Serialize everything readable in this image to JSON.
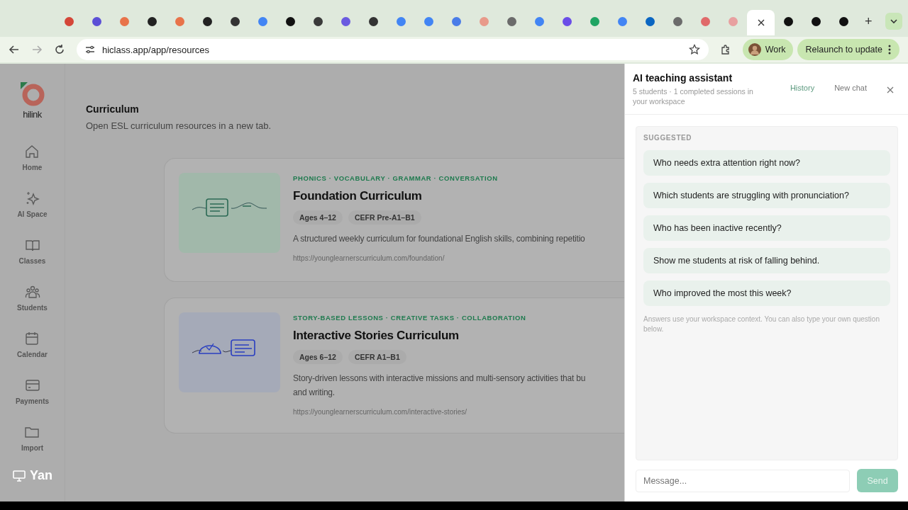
{
  "browser": {
    "tabs": [
      {
        "color": "#d44638",
        "selected": false
      },
      {
        "color": "#5b4fd6",
        "selected": false
      },
      {
        "color": "#e8734a",
        "selected": false
      },
      {
        "color": "#222222",
        "selected": false
      },
      {
        "color": "#e8734a",
        "selected": false
      },
      {
        "color": "#222222",
        "selected": false
      },
      {
        "color": "#333333",
        "selected": false
      },
      {
        "color": "#4285f4",
        "selected": false
      },
      {
        "color": "#111111",
        "selected": false
      },
      {
        "color": "#3a3a3a",
        "selected": false
      },
      {
        "color": "#6a5ae0",
        "selected": false
      },
      {
        "color": "#333333",
        "selected": false
      },
      {
        "color": "#4285f4",
        "selected": false
      },
      {
        "color": "#4285f4",
        "selected": false
      },
      {
        "color": "#4a7ce8",
        "selected": false
      },
      {
        "color": "#e89a8a",
        "selected": false
      },
      {
        "color": "#6b6b6b",
        "selected": false
      },
      {
        "color": "#4285f4",
        "selected": false
      },
      {
        "color": "#6a4de8",
        "selected": false
      },
      {
        "color": "#1fa463",
        "selected": false
      },
      {
        "color": "#4285f4",
        "selected": false
      },
      {
        "color": "#0a66c2",
        "selected": false
      },
      {
        "color": "#6b6b6b",
        "selected": false
      },
      {
        "color": "#e06a6a",
        "selected": false
      },
      {
        "color": "#e8a0a0",
        "selected": false
      },
      {
        "selected": true
      },
      {
        "color": "#111111",
        "selected": false
      },
      {
        "color": "#111111",
        "selected": false
      },
      {
        "color": "#111111",
        "selected": false
      }
    ],
    "new_tab": "+",
    "url": "hiclass.app/app/resources",
    "profile": "Work",
    "relaunch": "Relaunch to update"
  },
  "sidebar": {
    "logo_text": "hilink",
    "items": [
      {
        "label": "Home",
        "kind": "home"
      },
      {
        "label": "AI Space",
        "kind": "ai"
      },
      {
        "label": "Classes",
        "kind": "book"
      },
      {
        "label": "Students",
        "kind": "people"
      },
      {
        "label": "Calendar",
        "kind": "calendar"
      },
      {
        "label": "Payments",
        "kind": "card"
      },
      {
        "label": "Import",
        "kind": "folder"
      }
    ]
  },
  "page": {
    "title": "Curriculum",
    "subtitle": "Open ESL curriculum resources in a new tab.",
    "cards": [
      {
        "kind": "foundation",
        "tags": "PHONICS · VOCABULARY · GRAMMAR · CONVERSATION",
        "title": "Foundation Curriculum",
        "badges": [
          "Ages 4–12",
          "CEFR Pre-A1–B1"
        ],
        "description_lines": [
          "A structured weekly curriculum for foundational English skills, combining repetitio"
        ],
        "url": "https://younglearnerscurriculum.com/foundation/"
      },
      {
        "kind": "stories",
        "tags": "STORY-BASED LESSONS · CREATIVE TASKS · COLLABORATION",
        "title": "Interactive Stories Curriculum",
        "badges": [
          "Ages 6–12",
          "CEFR A1–B1"
        ],
        "description_lines": [
          "Story-driven lessons with interactive missions and multi-sensory activities that bu",
          "and writing."
        ],
        "url": "https://younglearnerscurriculum.com/interactive-stories/"
      }
    ]
  },
  "assistant": {
    "title": "AI teaching assistant",
    "subtitle": "5 students · 1 completed sessions in your workspace",
    "history": "History",
    "new_chat": "New chat",
    "section": "SUGGESTED",
    "suggestions": [
      "Who needs extra attention right now?",
      "Which students are struggling with pronunciation?",
      "Who has been inactive recently?",
      "Show me students at risk of falling behind.",
      "Who improved the most this week?"
    ],
    "note": "Answers use your workspace context. You can also type your own question below.",
    "message": {
      "placeholder": "Message..."
    },
    "send": "Send"
  },
  "presenter": {
    "name": "Yan"
  }
}
